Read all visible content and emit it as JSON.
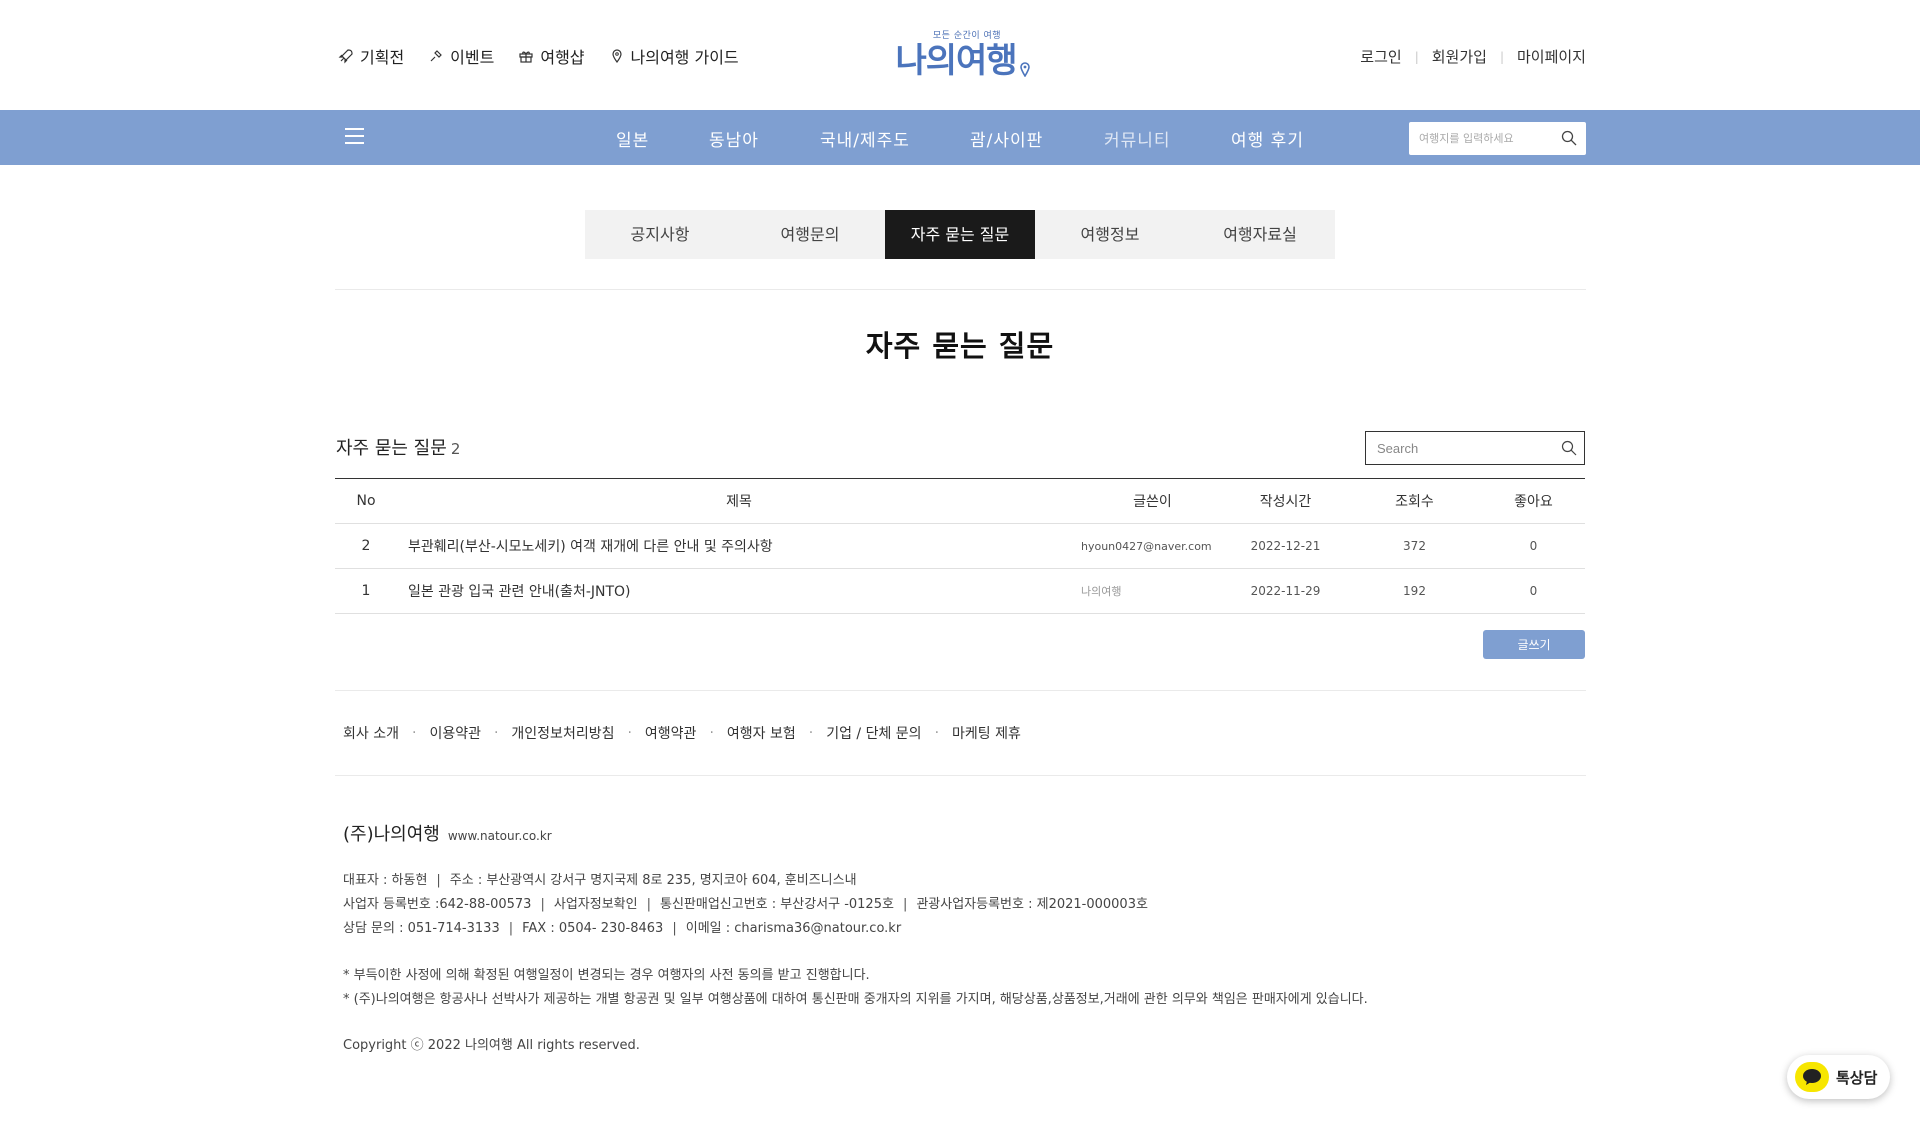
{
  "util_nav": [
    {
      "label": "기획전",
      "icon": "rocket-icon"
    },
    {
      "label": "이벤트",
      "icon": "pin-icon"
    },
    {
      "label": "여행샵",
      "icon": "gift-icon"
    },
    {
      "label": "나의여행 가이드",
      "icon": "location-icon"
    }
  ],
  "logo": {
    "tagline": "모든 순간이 여행",
    "name": "나의여행"
  },
  "member_nav": {
    "login": "로그인",
    "join": "회원가입",
    "mypage": "마이페이지"
  },
  "gnb": [
    "일본",
    "동남아",
    "국내/제주도",
    "괌/사이판",
    "커뮤니티",
    "여행 후기"
  ],
  "nav_search": {
    "placeholder": "여행지를 입력하세요"
  },
  "board_tabs": [
    "공지사항",
    "여행문의",
    "자주 묻는 질문",
    "여행정보",
    "여행자료실"
  ],
  "page_title": "자주 묻는 질문",
  "board": {
    "name": "자주 묻는 질문",
    "count": "2",
    "search_placeholder": "Search",
    "columns": [
      "No",
      "제목",
      "글쓴이",
      "작성시간",
      "조회수",
      "좋아요"
    ],
    "rows": [
      {
        "no": "2",
        "title": "부관훼리(부산-시모노세키) 여객 재개에 다른 안내 및 주의사항",
        "writer": "hyoun0427@naver.com",
        "date": "2022-12-21",
        "views": "372",
        "likes": "0"
      },
      {
        "no": "1",
        "title": "일본 관광 입국 관련 안내(출처-JNTO)",
        "writer": "나의여행",
        "date": "2022-11-29",
        "views": "192",
        "likes": "0"
      }
    ],
    "write_button": "글쓰기"
  },
  "footer": {
    "links": [
      "회사 소개",
      "이용약관",
      "개인정보처리방침",
      "여행약관",
      "여행자 보험",
      "기업 / 단체 문의",
      "마케팅 제휴"
    ],
    "company": "(주)나의여행",
    "url": "www.natour.co.kr",
    "info1": [
      "대표자 : 하동현",
      "주소 : 부산광역시 강서구 명지국제 8로 235, 명지코아 604, 훈비즈니스내"
    ],
    "info2": [
      "사업자 등록번호 :642-88-00573",
      "사업자정보확인",
      "통신판매업신고번호 : 부산강서구 -0125호",
      "관광사업자등록번호 :  제2021-000003호"
    ],
    "info3": [
      "상담 문의 : 051-714-3133",
      "FAX : 0504- 230-8463",
      "이메일 : charisma36@natour.co.kr"
    ],
    "notice1": "* 부득이한 사정에 의해 확정된 여행일정이 변경되는 경우 여행자의 사전 동의를 받고 진행합니다.",
    "notice2": "* (주)나의여행은 항공사나 선박사가 제공하는 개별 항공권  및 일부 여행상품에 대하여 통신판매 중개자의 지위를 가지며, 해당상품,상품정보,거래에 관한 의무와 책임은 판매자에게 있습니다.",
    "copyright": "Copyright ⓒ 2022 나의여행 All rights reserved."
  },
  "talk_button": "톡상담",
  "colors": {
    "nav_blue": "#7f9fd1",
    "logo_blue": "#4b74bc",
    "active_tab": "#1a1a1a",
    "kakao_yellow": "#f7e600"
  }
}
